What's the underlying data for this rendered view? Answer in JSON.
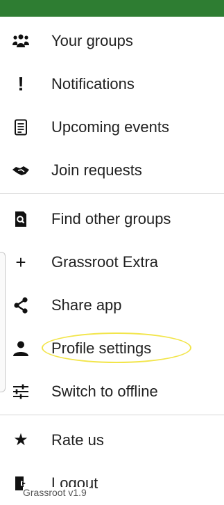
{
  "drawer": {
    "items": [
      {
        "label": "Your groups",
        "icon": "groups-icon"
      },
      {
        "label": "Notifications",
        "icon": "exclamation-icon"
      },
      {
        "label": "Upcoming events",
        "icon": "document-list-icon"
      },
      {
        "label": "Join requests",
        "icon": "handshake-icon"
      },
      {
        "label": "Find other groups",
        "icon": "search-doc-icon"
      },
      {
        "label": "Grassroot Extra",
        "icon": "plus-icon"
      },
      {
        "label": "Share app",
        "icon": "share-icon"
      },
      {
        "label": "Profile settings",
        "icon": "person-icon"
      },
      {
        "label": "Switch to offline",
        "icon": "sliders-icon"
      },
      {
        "label": "Rate us",
        "icon": "star-icon"
      },
      {
        "label": "Logout",
        "icon": "logout-icon"
      }
    ]
  },
  "footer": {
    "version": "Grassroot v1.9"
  },
  "colors": {
    "topbar": "#2e7d32",
    "highlight": "#f2e54a"
  }
}
